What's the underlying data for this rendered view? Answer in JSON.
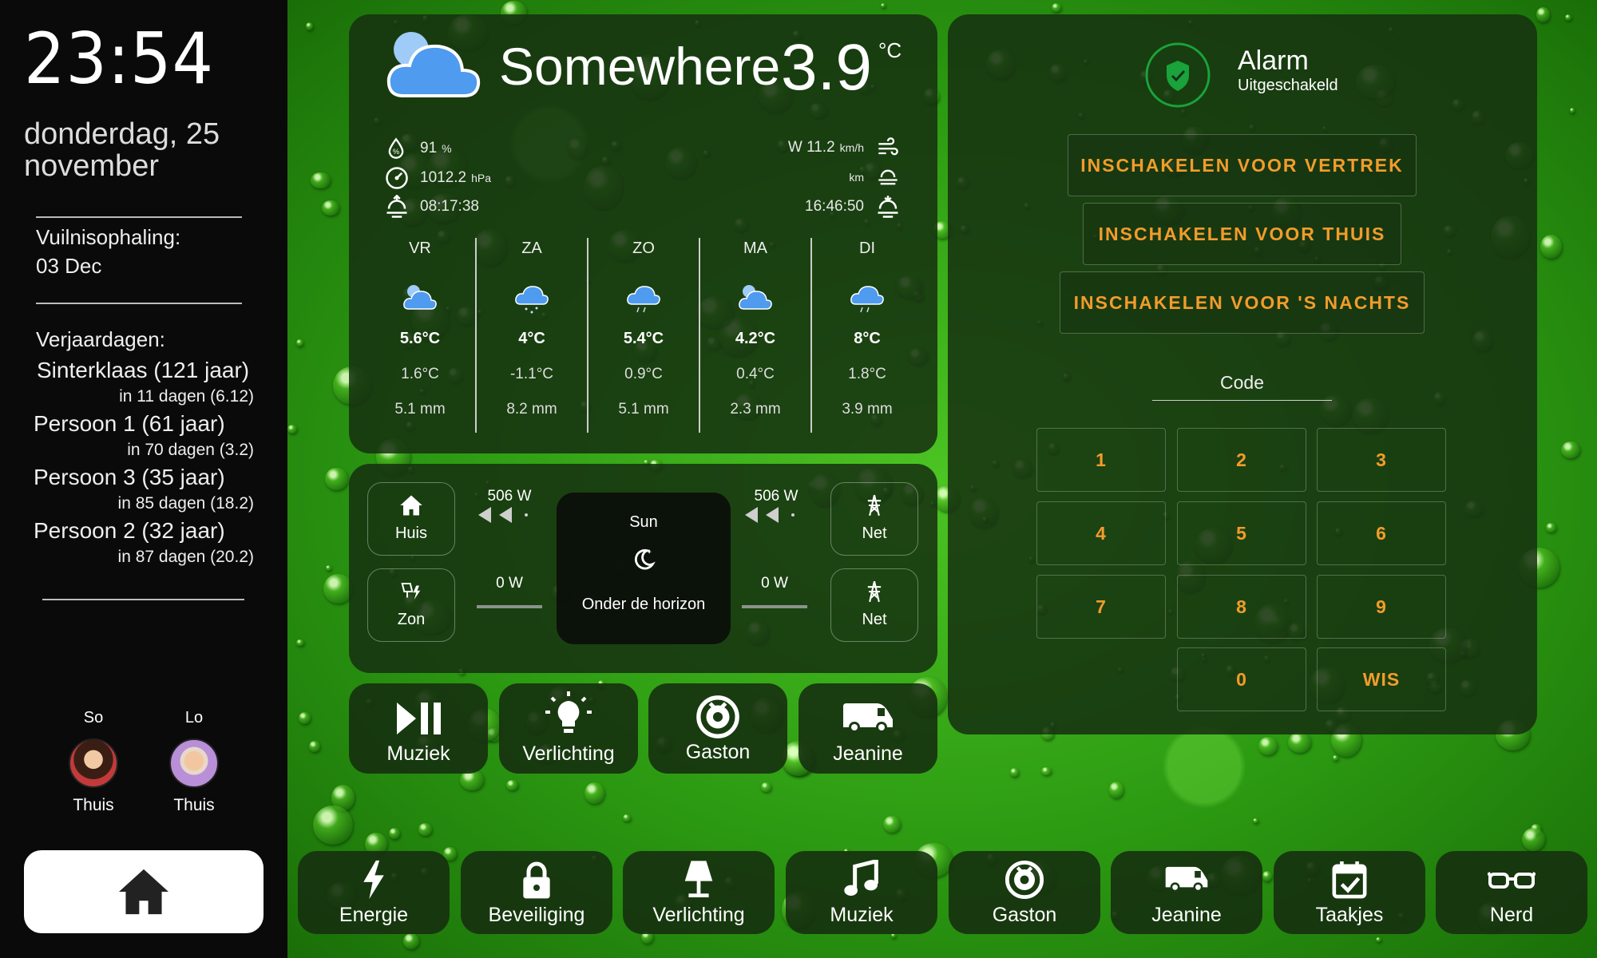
{
  "sidebar": {
    "time": "23:54",
    "date": "donderdag, 25 november",
    "waste_label": "Vuilnisophaling:",
    "waste_date": "03 Dec",
    "birthdays_label": "Verjaardagen:",
    "birthdays": [
      {
        "name": "Sinterklaas (121 jaar)",
        "when": "in 11 dagen (6.12)"
      },
      {
        "name": "Persoon 1 (61 jaar)",
        "when": "in 70 dagen (3.2)"
      },
      {
        "name": "Persoon 3 (35 jaar)",
        "when": "in 85 dagen (18.2)"
      },
      {
        "name": "Persoon 2 (32 jaar)",
        "when": "in 87 dagen (20.2)"
      }
    ],
    "people": [
      {
        "name": "So",
        "state": "Thuis"
      },
      {
        "name": "Lo",
        "state": "Thuis"
      }
    ],
    "home_icon": "home-icon"
  },
  "weather": {
    "location": "Somewhere",
    "temp": "3.9",
    "unit": "°C",
    "humidity": "91",
    "humidity_unit": "%",
    "pressure": "1012.2",
    "pressure_unit": "hPa",
    "sunrise": "08:17:38",
    "wind": "W 11.2",
    "wind_unit": "km/h",
    "visibility_unit": "km",
    "sunset": "16:46:50",
    "forecast": [
      {
        "day": "VR",
        "hi": "5.6°C",
        "lo": "1.6°C",
        "rain": "5.1 mm",
        "icon": "cloudy-icon"
      },
      {
        "day": "ZA",
        "hi": "4°C",
        "lo": "-1.1°C",
        "rain": "8.2 mm",
        "icon": "snowy-rain-icon"
      },
      {
        "day": "ZO",
        "hi": "5.4°C",
        "lo": "0.9°C",
        "rain": "5.1 mm",
        "icon": "rain-icon"
      },
      {
        "day": "MA",
        "hi": "4.2°C",
        "lo": "0.4°C",
        "rain": "2.3 mm",
        "icon": "cloudy-icon"
      },
      {
        "day": "DI",
        "hi": "8°C",
        "lo": "1.8°C",
        "rain": "3.9 mm",
        "icon": "rain-icon"
      }
    ]
  },
  "energy": {
    "home_label": "Huis",
    "solar_label": "Zon",
    "grid_label_top": "Net",
    "grid_label_bottom": "Net",
    "flow_left_top": "506 W",
    "flow_left_bottom": "0 W",
    "flow_right_top": "506 W",
    "flow_right_bottom": "0 W",
    "sun_title": "Sun",
    "sun_state": "Onder de horizon"
  },
  "tiles": [
    {
      "label": "Muziek",
      "icon": "play-pause-icon"
    },
    {
      "label": "Verlichting",
      "icon": "lightbulb-icon"
    },
    {
      "label": "Gaston",
      "icon": "robot-vacuum-icon"
    },
    {
      "label": "Jeanine",
      "icon": "van-icon"
    }
  ],
  "alarm": {
    "title": "Alarm",
    "status": "Uitgeschakeld",
    "buttons": [
      "INSCHAKELEN VOOR VERTREK",
      "INSCHAKELEN VOOR THUIS",
      "INSCHAKELEN VOOR 'S NACHTS"
    ],
    "code_label": "Code",
    "keys": [
      "1",
      "2",
      "3",
      "4",
      "5",
      "6",
      "7",
      "8",
      "9",
      "0",
      "WIS"
    ]
  },
  "nav": [
    {
      "label": "Energie",
      "icon": "lightning-icon"
    },
    {
      "label": "Beveiliging",
      "icon": "lock-icon"
    },
    {
      "label": "Verlichting",
      "icon": "lamp-icon"
    },
    {
      "label": "Muziek",
      "icon": "music-note-icon"
    },
    {
      "label": "Gaston",
      "icon": "robot-vacuum-icon"
    },
    {
      "label": "Jeanine",
      "icon": "van-icon"
    },
    {
      "label": "Taakjes",
      "icon": "calendar-check-icon"
    },
    {
      "label": "Nerd",
      "icon": "glasses-icon"
    }
  ],
  "colors": {
    "accent": "#f29c2b",
    "shield": "#19a33a",
    "cloud": "#4e9bf0"
  }
}
